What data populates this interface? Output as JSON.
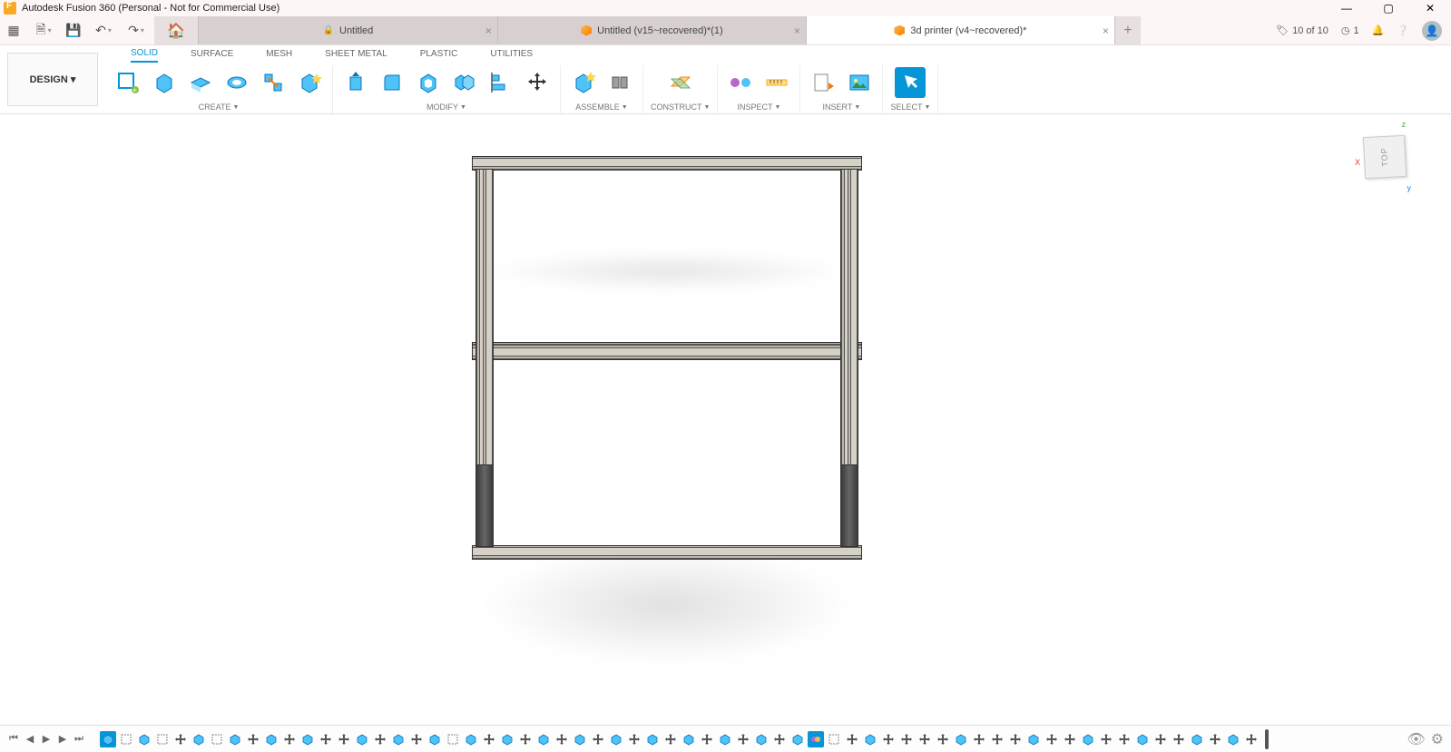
{
  "window": {
    "title": "Autodesk Fusion 360 (Personal - Not for Commercial Use)"
  },
  "tabs": {
    "home_tooltip": "Home",
    "items": [
      {
        "label": "Untitled",
        "locked": true,
        "active": false
      },
      {
        "label": "Untitled (v15~recovered)*(1)",
        "locked": false,
        "active": false
      },
      {
        "label": "3d printer (v4~recovered)*",
        "locked": false,
        "active": true
      }
    ]
  },
  "status": {
    "recovery_count": "10 of 10",
    "jobs": "1"
  },
  "workspace": {
    "label": "DESIGN"
  },
  "ribbon": {
    "tabs": [
      "SOLID",
      "SURFACE",
      "MESH",
      "SHEET METAL",
      "PLASTIC",
      "UTILITIES"
    ],
    "active_tab": "SOLID",
    "groups": {
      "create": "CREATE",
      "modify": "MODIFY",
      "assemble": "ASSEMBLE",
      "construct": "CONSTRUCT",
      "inspect": "INSPECT",
      "insert": "INSERT",
      "select": "SELECT"
    }
  },
  "viewcube": {
    "face": "TOP",
    "axis_x": "X",
    "axis_y": "y",
    "axis_z": "z"
  },
  "timeline": {
    "play_controls": [
      "start",
      "prev",
      "play",
      "next",
      "end"
    ]
  }
}
